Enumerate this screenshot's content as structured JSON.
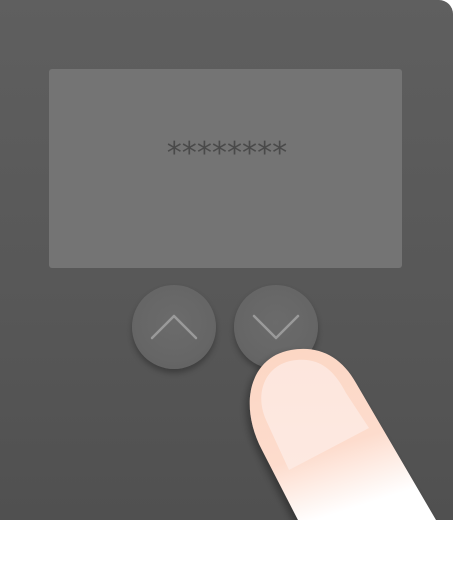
{
  "display": {
    "masked_value": "********"
  },
  "buttons": {
    "up": {
      "icon": "chevron-up-icon"
    },
    "down": {
      "icon": "chevron-down-icon"
    }
  },
  "colors": {
    "device_body": "#575757",
    "screen": "#747474",
    "button": "#666666",
    "chevron": "#9a9a9a",
    "finger_skin": "#fcd9c8",
    "finger_nail": "#fde8df"
  }
}
